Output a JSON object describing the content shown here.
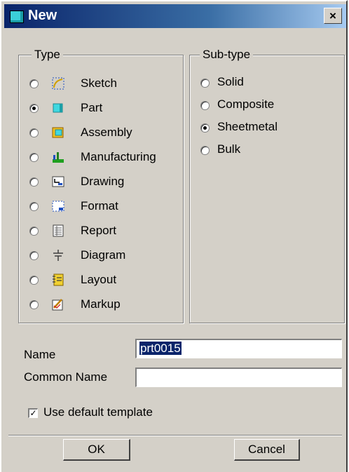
{
  "window": {
    "title": "New",
    "close_label": "×"
  },
  "type_group": {
    "title": "Type",
    "items": [
      {
        "label": "Sketch",
        "icon": "sketch-icon",
        "checked": false
      },
      {
        "label": "Part",
        "icon": "part-icon",
        "checked": true
      },
      {
        "label": "Assembly",
        "icon": "assembly-icon",
        "checked": false
      },
      {
        "label": "Manufacturing",
        "icon": "manufacturing-icon",
        "checked": false
      },
      {
        "label": "Drawing",
        "icon": "drawing-icon",
        "checked": false
      },
      {
        "label": "Format",
        "icon": "format-icon",
        "checked": false
      },
      {
        "label": "Report",
        "icon": "report-icon",
        "checked": false
      },
      {
        "label": "Diagram",
        "icon": "diagram-icon",
        "checked": false
      },
      {
        "label": "Layout",
        "icon": "layout-icon",
        "checked": false
      },
      {
        "label": "Markup",
        "icon": "markup-icon",
        "checked": false
      }
    ]
  },
  "subtype_group": {
    "title": "Sub-type",
    "items": [
      {
        "label": "Solid",
        "checked": false
      },
      {
        "label": "Composite",
        "checked": false
      },
      {
        "label": "Sheetmetal",
        "checked": true
      },
      {
        "label": "Bulk",
        "checked": false
      }
    ]
  },
  "form": {
    "name_label": "Name",
    "name_value": "prt0015",
    "common_name_label": "Common Name",
    "common_name_value": "",
    "use_template_label": "Use default template",
    "use_template_checked": true
  },
  "buttons": {
    "ok": "OK",
    "cancel": "Cancel"
  },
  "colors": {
    "titlebar_start": "#0a246a",
    "dialog_bg": "#d4d0c8",
    "selection": "#0a246a"
  }
}
